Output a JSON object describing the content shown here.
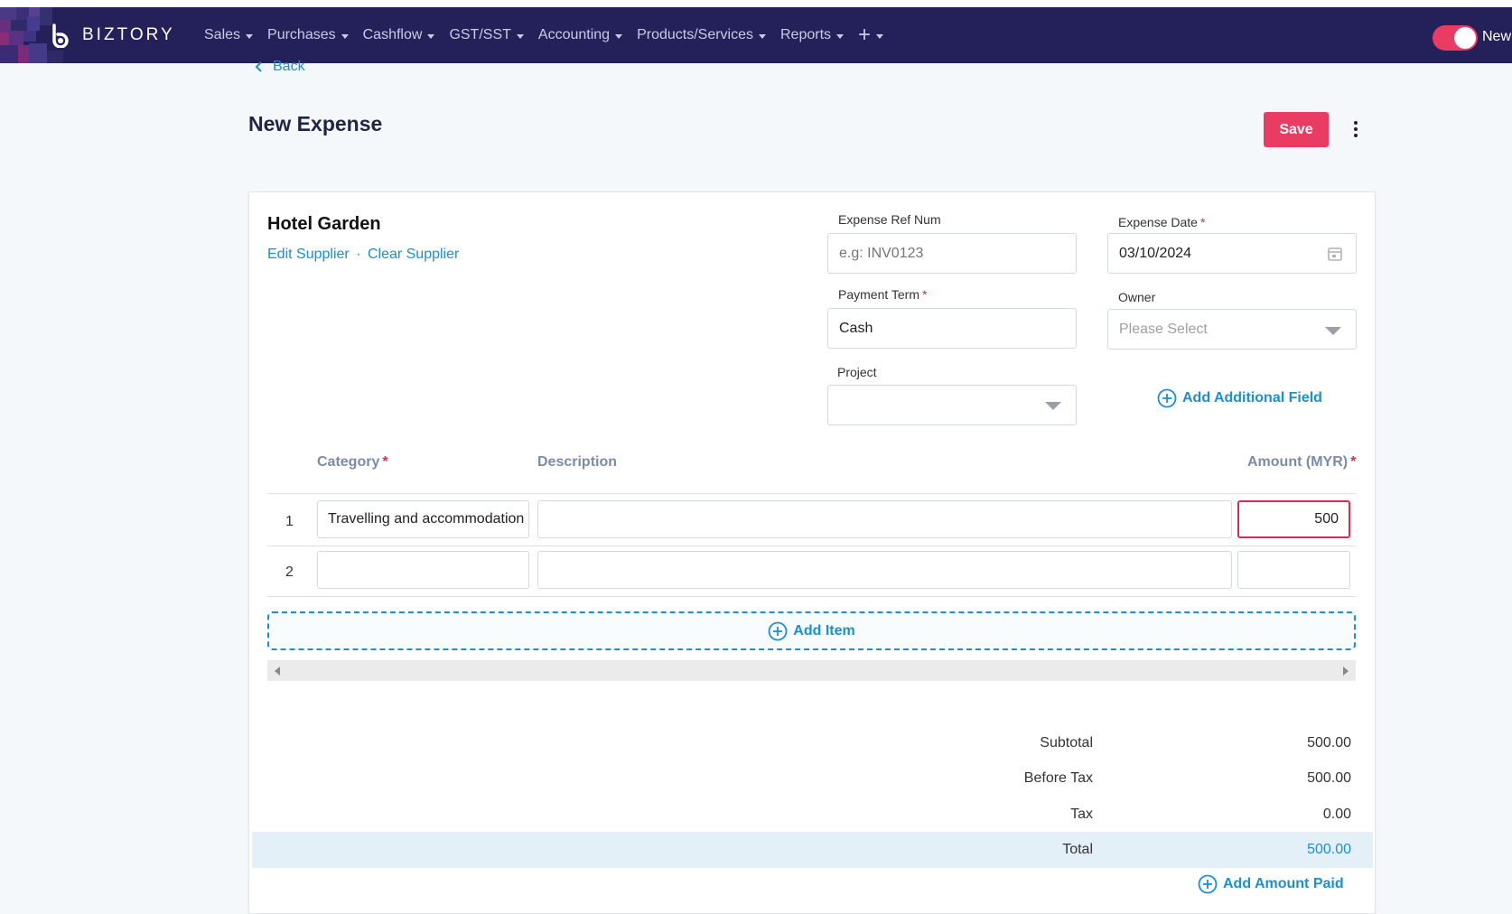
{
  "nav": {
    "brand": "BIZTORY",
    "menu": [
      "Sales",
      "Purchases",
      "Cashflow",
      "GST/SST",
      "Accounting",
      "Products/Services",
      "Reports"
    ],
    "toggle_label": "New"
  },
  "header": {
    "back_label": "Back",
    "title": "New Expense",
    "save_label": "Save"
  },
  "supplier": {
    "name": "Hotel Garden",
    "edit_label": "Edit Supplier",
    "separator": "·",
    "clear_label": "Clear Supplier"
  },
  "fields": {
    "ref_num": {
      "label": "Expense Ref Num",
      "placeholder": "e.g: INV0123",
      "value": ""
    },
    "expense_date": {
      "label": "Expense Date",
      "required": "*",
      "value": "03/10/2024"
    },
    "payment_term": {
      "label": "Payment Term",
      "required": "*",
      "value": "Cash"
    },
    "owner": {
      "label": "Owner",
      "placeholder": "Please Select"
    },
    "project": {
      "label": "Project",
      "value": ""
    },
    "add_additional_label": "Add Additional Field"
  },
  "table": {
    "headers": {
      "category": "Category",
      "description": "Description",
      "amount": "Amount (MYR)",
      "required": "*"
    },
    "rows": [
      {
        "num": "1",
        "category": "Travelling and accommodation",
        "description": "",
        "amount": "500"
      },
      {
        "num": "2",
        "category": "",
        "description": "",
        "amount": ""
      }
    ],
    "add_item_label": "Add Item"
  },
  "totals": {
    "subtotal_label": "Subtotal",
    "subtotal": "500.00",
    "before_tax_label": "Before Tax",
    "before_tax": "500.00",
    "tax_label": "Tax",
    "tax": "0.00",
    "total_label": "Total",
    "total": "500.00",
    "add_amount_paid_label": "Add Amount Paid"
  },
  "colors": {
    "nav_bg": "#24205a",
    "accent_red": "#ea3c63",
    "link_blue": "#1b8fd1",
    "total_band": "#e3f0f8"
  },
  "icons": [
    "back-chevron-icon",
    "caret-down-icon",
    "plus-icon",
    "kebab-icon",
    "calendar-icon",
    "chevron-down-icon",
    "circle-plus-icon",
    "scroll-left-icon",
    "scroll-right-icon"
  ]
}
